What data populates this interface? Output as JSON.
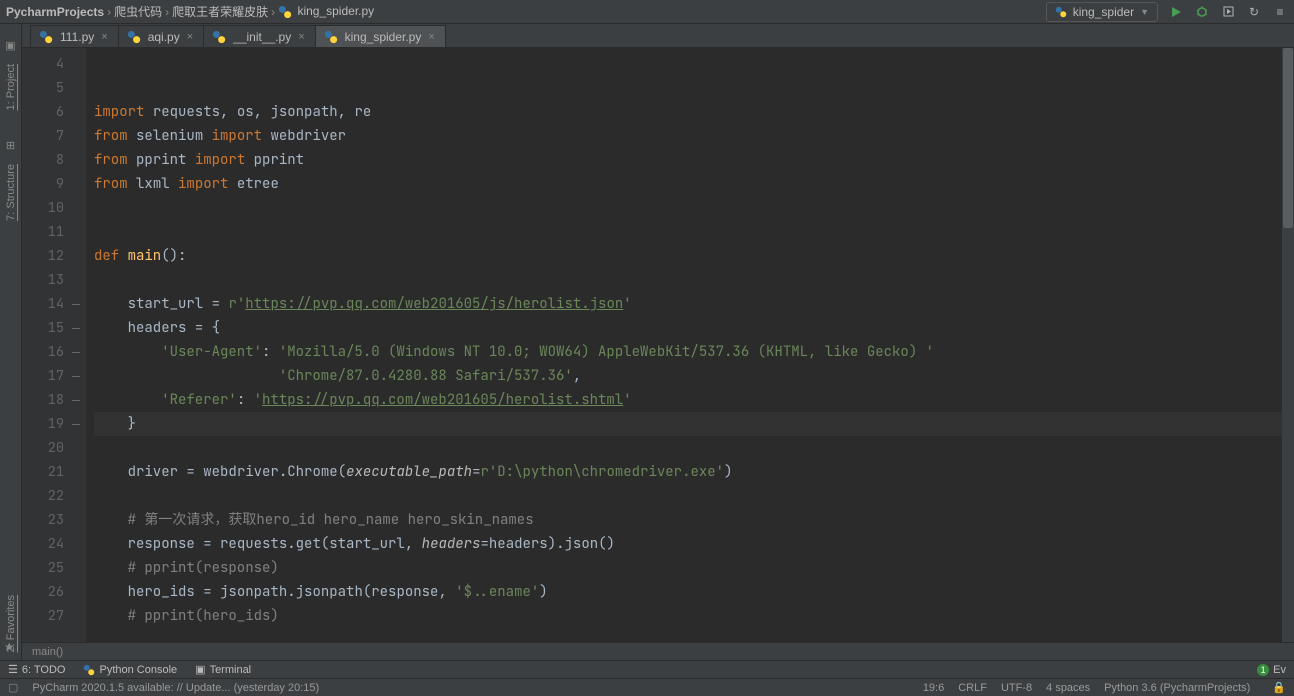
{
  "breadcrumbs": [
    "PycharmProjects",
    "爬虫代码",
    "爬取王者荣耀皮肤",
    "king_spider.py"
  ],
  "run_config": {
    "label": "king_spider"
  },
  "tabs": [
    {
      "label": "111.py",
      "active": false
    },
    {
      "label": "aqi.py",
      "active": false
    },
    {
      "label": "__init__.py",
      "active": false
    },
    {
      "label": "king_spider.py",
      "active": true
    }
  ],
  "left_tools": {
    "t1": "1: Project",
    "t2": "7: Structure",
    "t3": "2: Favorites"
  },
  "gutter_start": 4,
  "gutter_end": 27,
  "code_lines": [
    {
      "n": 4,
      "html": ""
    },
    {
      "n": 5,
      "html": ""
    },
    {
      "n": 6,
      "html": "<span class='kw'>import</span> <span class='ident'>requests</span><span class='op'>,</span> <span class='ident'>os</span><span class='op'>,</span> <span class='ident'>jsonpath</span><span class='op'>,</span> <span class='ident'>re</span>"
    },
    {
      "n": 7,
      "html": "<span class='kw'>from</span> <span class='ident'>selenium</span> <span class='kw'>import</span> <span class='ident'>webdriver</span>"
    },
    {
      "n": 8,
      "html": "<span class='kw'>from</span> <span class='ident'>pprint</span> <span class='kw'>import</span> <span class='ident'>pprint</span>"
    },
    {
      "n": 9,
      "html": "<span class='kw'>from</span> <span class='ident'>lxml</span> <span class='kw'>import</span> <span class='ident'>etree</span>"
    },
    {
      "n": 10,
      "html": ""
    },
    {
      "n": 11,
      "html": ""
    },
    {
      "n": 12,
      "html": "<span class='kw'>def</span> <span class='func'>main</span><span class='op'>():</span>"
    },
    {
      "n": 13,
      "html": ""
    },
    {
      "n": 14,
      "html": "    <span class='ident'>start_url</span> <span class='op'>=</span> <span class='prefix'>r</span><span class='str'>'</span><span class='url'>https://pvp.qq.com/web201605/js/herolist.json</span><span class='str'>'</span>"
    },
    {
      "n": 15,
      "html": "    <span class='ident'>headers</span> <span class='op'>=</span> <span class='op'>{</span>"
    },
    {
      "n": 16,
      "html": "        <span class='str'>'User-Agent'</span><span class='op'>:</span> <span class='str'>'Mozilla/5.0 (Windows NT 10.0; WOW64) AppleWebKit/537.36 (KHTML, like Gecko) '</span>"
    },
    {
      "n": 17,
      "html": "                      <span class='str'>'Chrome/87.0.4280.88 Safari/537.36'</span><span class='op'>,</span>"
    },
    {
      "n": 18,
      "html": "        <span class='str'>'Referer'</span><span class='op'>:</span> <span class='str'>'</span><span class='url'>https://pvp.qq.com/web201605/herolist.shtml</span><span class='str'>'</span>"
    },
    {
      "n": 19,
      "html": "    <span class='op'>}</span>",
      "current": true
    },
    {
      "n": 20,
      "html": ""
    },
    {
      "n": 21,
      "html": "    <span class='ident'>driver</span> <span class='op'>=</span> <span class='ident'>webdriver</span><span class='op'>.</span><span class='ident'>Chrome</span><span class='op'>(</span><span class='param'>executable_path</span><span class='op'>=</span><span class='prefix'>r</span><span class='str'>'D:\\python\\chromedriver.exe'</span><span class='op'>)</span>"
    },
    {
      "n": 22,
      "html": ""
    },
    {
      "n": 23,
      "html": "    <span class='cmt'># 第一次请求，获取hero_id hero_name hero_skin_names</span>"
    },
    {
      "n": 24,
      "html": "    <span class='ident'>response</span> <span class='op'>=</span> <span class='ident'>requests</span><span class='op'>.</span><span class='ident'>get</span><span class='op'>(</span><span class='ident'>start_url</span><span class='op'>,</span> <span class='param'>headers</span><span class='op'>=</span><span class='ident'>headers</span><span class='op'>).</span><span class='ident'>json</span><span class='op'>()</span>"
    },
    {
      "n": 25,
      "html": "    <span class='cmt'># pprint(response)</span>"
    },
    {
      "n": 26,
      "html": "    <span class='ident'>hero_ids</span> <span class='op'>=</span> <span class='ident'>jsonpath</span><span class='op'>.</span><span class='ident'>jsonpath</span><span class='op'>(</span><span class='ident'>response</span><span class='op'>,</span> <span class='str'>'$..ename'</span><span class='op'>)</span>"
    },
    {
      "n": 27,
      "html": "    <span class='cmt'># pprint(hero_ids)</span>"
    }
  ],
  "crumb_fn": "main()",
  "bottom": {
    "todo": "6: TODO",
    "pyconsole": "Python Console",
    "terminal": "Terminal",
    "events": "Ev",
    "event_badge": "1"
  },
  "status": {
    "msg": "PyCharm 2020.1.5 available: // Update... (yesterday 20:15)",
    "pos": "19:6",
    "eol": "CRLF",
    "enc": "UTF-8",
    "indent": "4 spaces",
    "interp": "Python 3.6 (PycharmProjects)"
  }
}
